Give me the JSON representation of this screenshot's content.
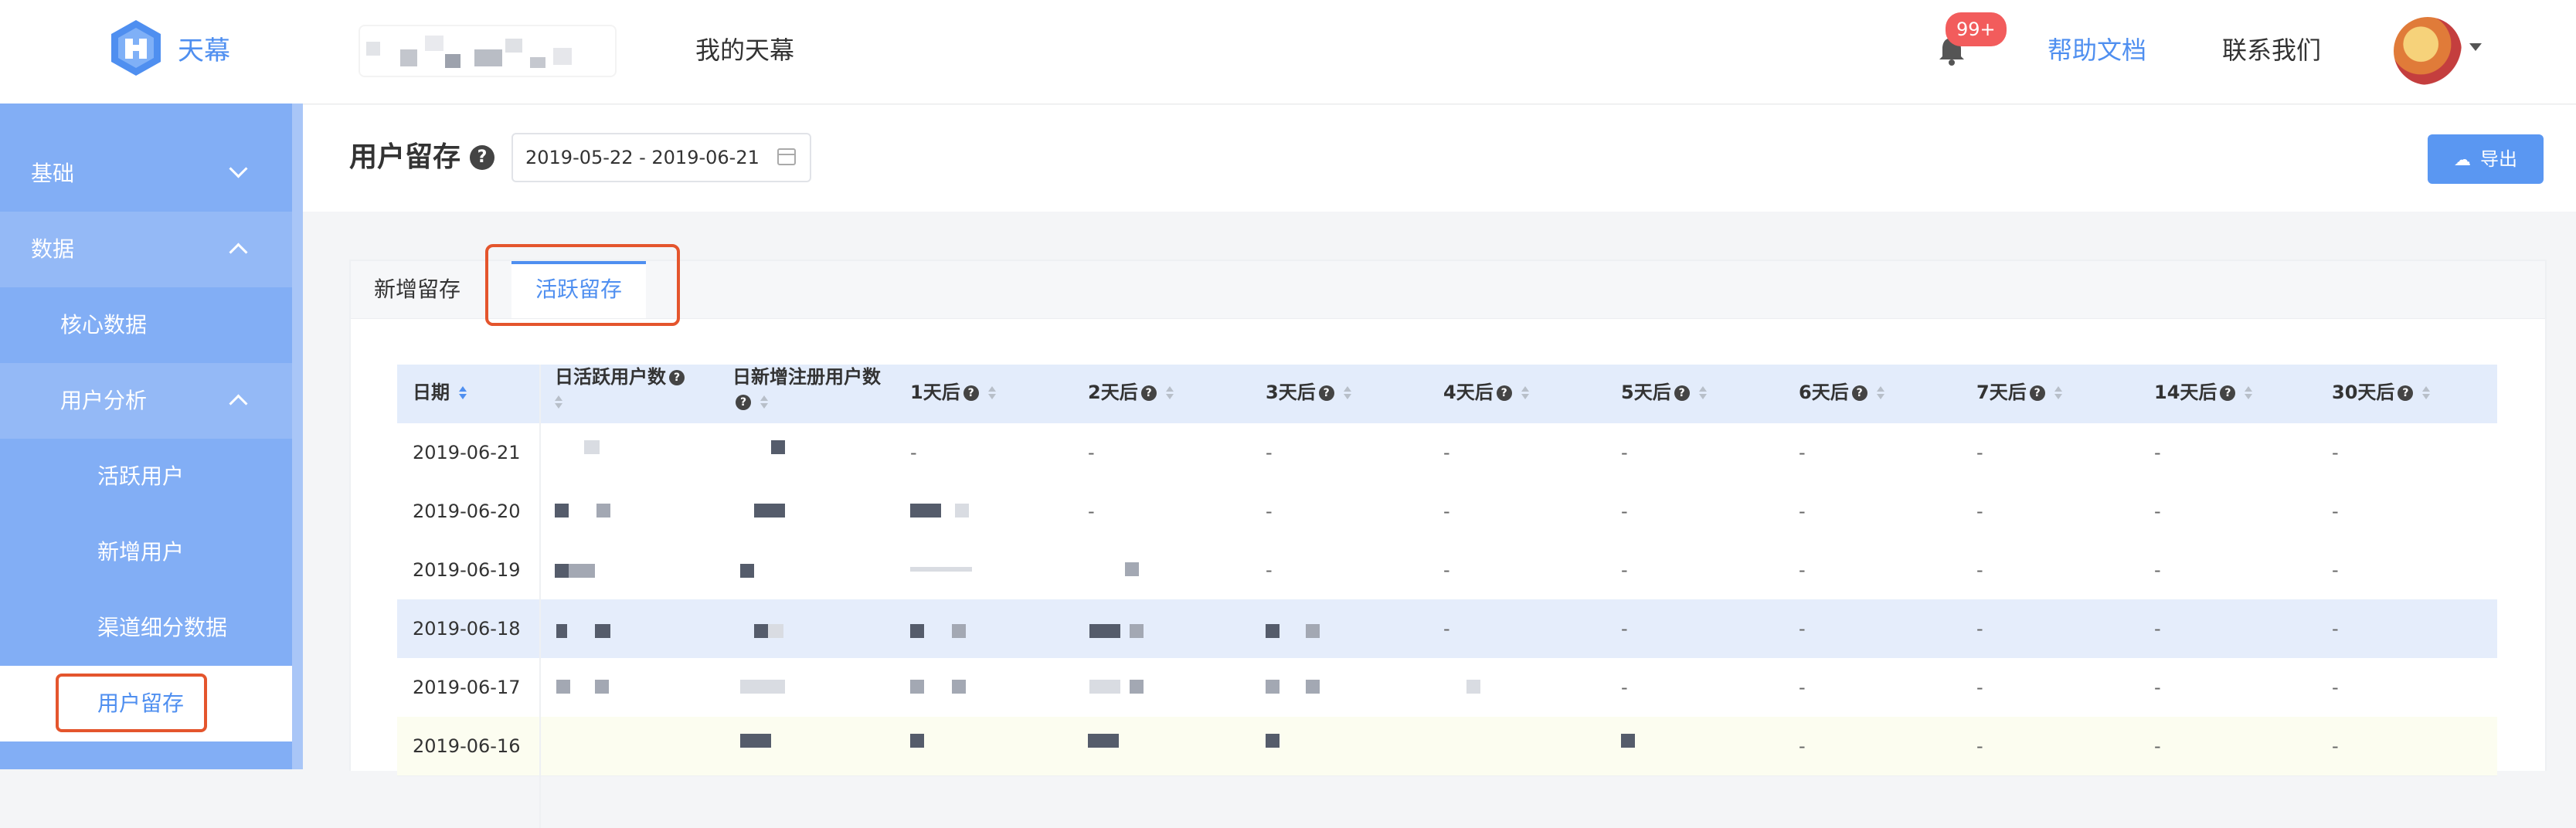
{
  "header": {
    "logo_text": "天幕",
    "nav_my": "我的天幕",
    "badge": "99+",
    "help": "帮助文档",
    "contact": "联系我们"
  },
  "sidebar": {
    "items": [
      {
        "label": "基础"
      },
      {
        "label": "数据"
      },
      {
        "label": "核心数据"
      },
      {
        "label": "用户分析"
      },
      {
        "label": "活跃用户"
      },
      {
        "label": "新增用户"
      },
      {
        "label": "渠道细分数据"
      },
      {
        "label": "用户留存"
      }
    ]
  },
  "toolbar": {
    "title": "用户留存",
    "help_mark": "?",
    "date_range": "2019-05-22 - 2019-06-21",
    "export_label": "导出"
  },
  "tabs": [
    {
      "label": "新增留存"
    },
    {
      "label": "活跃留存"
    }
  ],
  "table": {
    "headers": [
      "日期",
      "日活跃用户数",
      "日新增注册用户数",
      "1天后",
      "2天后",
      "3天后",
      "4天后",
      "5天后",
      "6天后",
      "7天后",
      "14天后",
      "30天后"
    ],
    "rows": [
      {
        "date": "2019-06-21",
        "dash": "-"
      },
      {
        "date": "2019-06-20",
        "dash": "-"
      },
      {
        "date": "2019-06-19",
        "dash": "-"
      },
      {
        "date": "2019-06-18",
        "dash": "-"
      },
      {
        "date": "2019-06-17",
        "dash": "-"
      },
      {
        "date": "2019-06-16",
        "dash": "-"
      }
    ]
  },
  "colors": {
    "accent": "#4f8ff0",
    "sidebar": "#82aef5",
    "highlight_border": "#e4552d"
  }
}
